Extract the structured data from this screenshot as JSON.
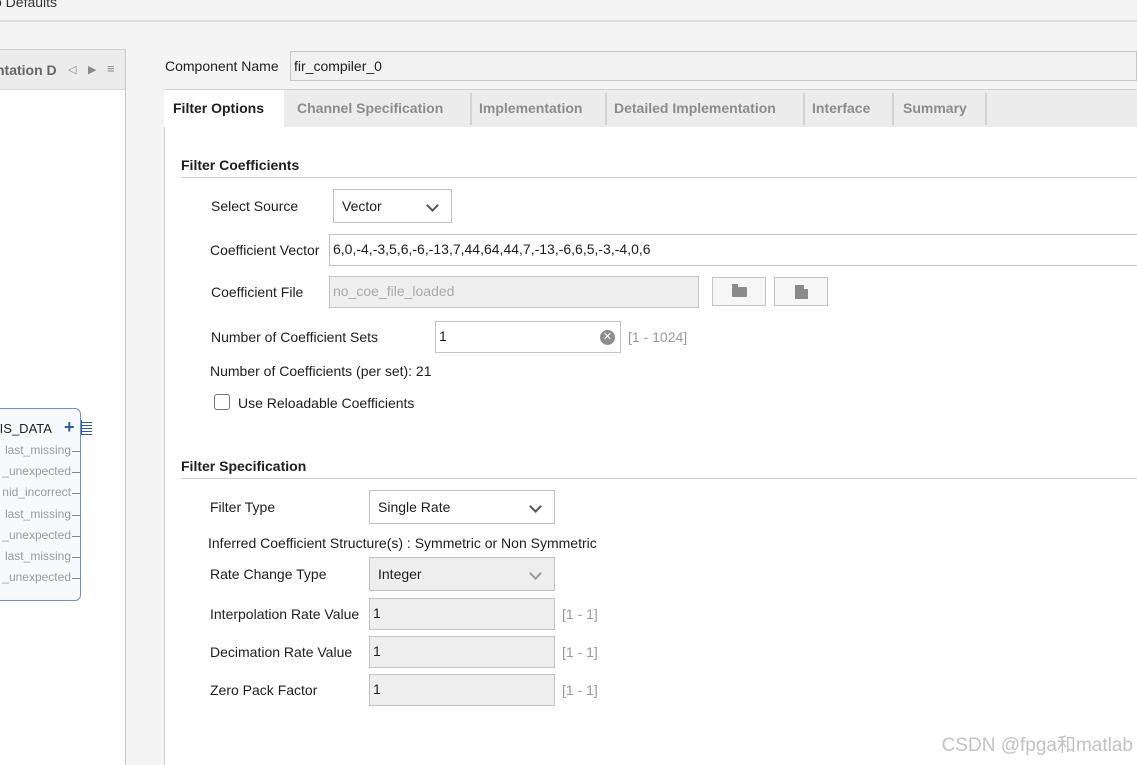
{
  "window": {
    "title": "o Defaults"
  },
  "left_panel": {
    "title": "ntation D",
    "nav_prev_icon": "triangle-left",
    "nav_next_icon": "triangle-right",
    "menu_icon": "hamburger",
    "symbol": {
      "bus_label": "KIS_DATA",
      "ports": [
        "last_missing",
        "_unexpected",
        "nid_incorrect",
        "last_missing",
        "_unexpected",
        "last_missing",
        "_unexpected"
      ]
    }
  },
  "component": {
    "label": "Component Name",
    "value": "fir_compiler_0"
  },
  "tabs": [
    {
      "label": "Filter Options",
      "active": true
    },
    {
      "label": "Channel Specification",
      "active": false
    },
    {
      "label": "Implementation",
      "active": false
    },
    {
      "label": "Detailed Implementation",
      "active": false
    },
    {
      "label": "Interface",
      "active": false
    },
    {
      "label": "Summary",
      "active": false
    }
  ],
  "filter_coefficients": {
    "title": "Filter Coefficients",
    "select_source": {
      "label": "Select Source",
      "value": "Vector"
    },
    "coefficient_vector": {
      "label": "Coefficient Vector",
      "value": "6,0,-4,-3,5,6,-6,-13,7,44,64,44,7,-13,-6,6,5,-3,-4,0,6"
    },
    "coefficient_file": {
      "label": "Coefficient File",
      "placeholder": "no_coe_file_loaded",
      "browse_icon": "folder-icon",
      "edit_icon": "save-icon"
    },
    "num_coefficient_sets": {
      "label": "Number of Coefficient Sets",
      "value": "1",
      "range": "[1 - 1024]"
    },
    "num_coefficients_text": "Number of Coefficients (per set): 21",
    "reloadable": {
      "label": "Use Reloadable Coefficients",
      "checked": false
    }
  },
  "filter_specification": {
    "title": "Filter Specification",
    "filter_type": {
      "label": "Filter Type",
      "value": "Single Rate"
    },
    "inferred_text": "Inferred Coefficient Structure(s) : Symmetric or Non Symmetric",
    "rate_change_type": {
      "label": "Rate Change Type",
      "value": "Integer"
    },
    "interpolation_rate": {
      "label": "Interpolation Rate Value",
      "value": "1",
      "range": "[1 - 1]"
    },
    "decimation_rate": {
      "label": "Decimation Rate Value",
      "value": "1",
      "range": "[1 - 1]"
    },
    "zero_pack_factor": {
      "label": "Zero Pack Factor",
      "value": "1",
      "range": "[1 - 1]"
    }
  },
  "watermark": "CSDN @fpga和matlab"
}
